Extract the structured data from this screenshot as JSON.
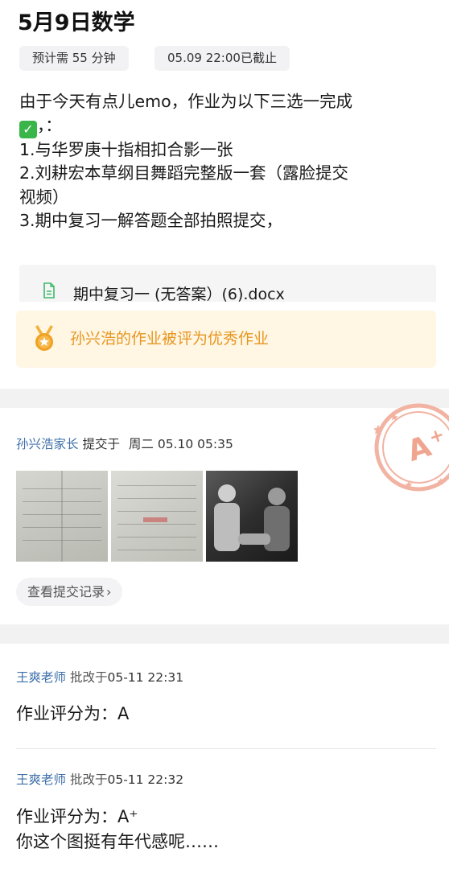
{
  "header": {
    "title": "5月9日数学",
    "estimate_chip": "预计需 55 分钟",
    "deadline_chip": "05.09  22:00已截止"
  },
  "assignment": {
    "line1_text": "由于今天有点儿emo，作业为以下三选一完成",
    "line2_suffix": "，：",
    "check_icon": "check-mark-icon",
    "line3": "1.与华罗庚十指相扣合影一张",
    "line4": "2.刘耕宏本草纲目舞蹈完整版一套（露脸提交",
    "line5": "视频）",
    "line6": "3.期中复习一解答题全部拍照提交，"
  },
  "attachment": {
    "file_name": "期中复习一 (无答案）(6).docx",
    "icon": "document-icon"
  },
  "award_banner": {
    "text": "孙兴浩的作业被评为优秀作业",
    "icon": "medal-icon",
    "color": "#e7961f"
  },
  "submission": {
    "submitter": "孙兴浩家长",
    "action": "提交于",
    "time": "周二 05.10 05:35",
    "images": [
      "homework-photo-1",
      "homework-photo-2",
      "photo-with-portrait"
    ],
    "history_button": "查看提交记录",
    "stamp_grade": "A+"
  },
  "reviews": [
    {
      "teacher": "王爽老师",
      "action": "批改于",
      "time": "05-11 22:31",
      "comment_lines": [
        "作业评分为：A"
      ]
    },
    {
      "teacher": "王爽老师",
      "action": "批改于",
      "time": "05-11 22:32",
      "comment_lines": [
        "作业评分为：A⁺",
        "你这个图挺有年代感呢……"
      ]
    }
  ],
  "colors": {
    "link_blue": "#3d6fa8",
    "stamp_orange": "#f0a590",
    "check_green": "#39b54a"
  }
}
